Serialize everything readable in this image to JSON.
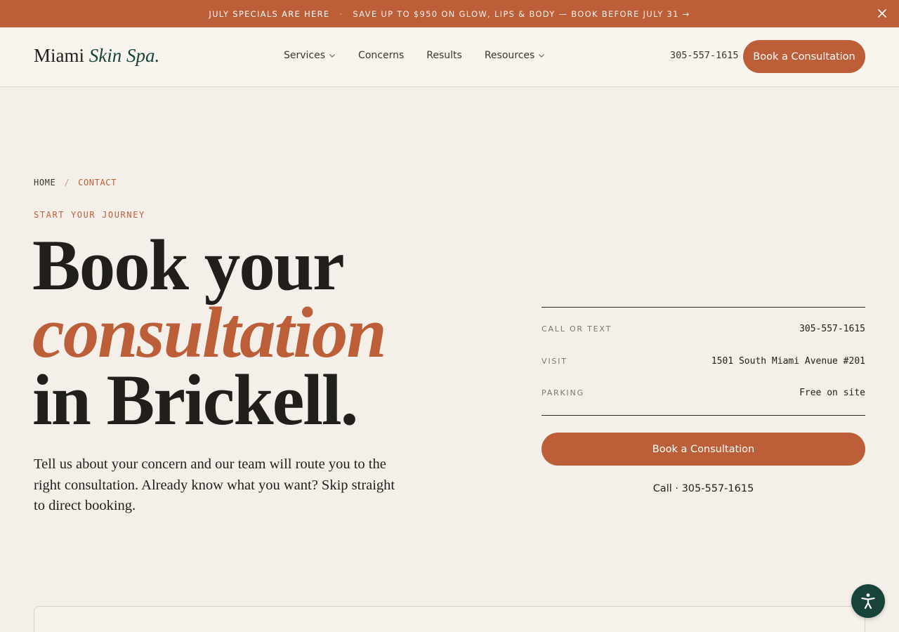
{
  "promo": {
    "headline": "JULY SPECIALS ARE HERE",
    "separator": "·",
    "message": "SAVE UP TO $950 ON GLOW, LIPS & BODY — BOOK BEFORE JULY 31 →"
  },
  "header": {
    "logo_main": "Miami",
    "logo_accent": "Skin Spa.",
    "nav": [
      {
        "label": "Services",
        "has_dropdown": true
      },
      {
        "label": "Concerns",
        "has_dropdown": false
      },
      {
        "label": "Results",
        "has_dropdown": false
      },
      {
        "label": "Resources",
        "has_dropdown": true
      }
    ],
    "phone": "305-557-1615",
    "cta_label": "Book a Consultation"
  },
  "breadcrumb": {
    "home": "HOME",
    "separator": "/",
    "current": "CONTACT"
  },
  "hero": {
    "eyebrow": "START YOUR JOURNEY",
    "title_line1": "Book your",
    "title_accent": "consultation",
    "title_line3": "in Brickell.",
    "lede": "Tell us about your concern and our team will route you to the right consultation. Already know what you want? Skip straight to direct booking."
  },
  "info": {
    "rows": [
      {
        "label": "CALL OR TEXT",
        "value": "305-557-1615"
      },
      {
        "label": "VISIT",
        "value": "1501 South Miami Avenue #201"
      },
      {
        "label": "PARKING",
        "value": "Free on site"
      }
    ],
    "cta_label": "Book a Consultation",
    "call_line": "Call · 305-557-1615"
  },
  "colors": {
    "accent": "#bc5e38",
    "brand_green": "#16443b",
    "background": "#f4efe8"
  },
  "icons": [
    "close-icon",
    "chevron-down-icon",
    "accessibility-icon"
  ]
}
